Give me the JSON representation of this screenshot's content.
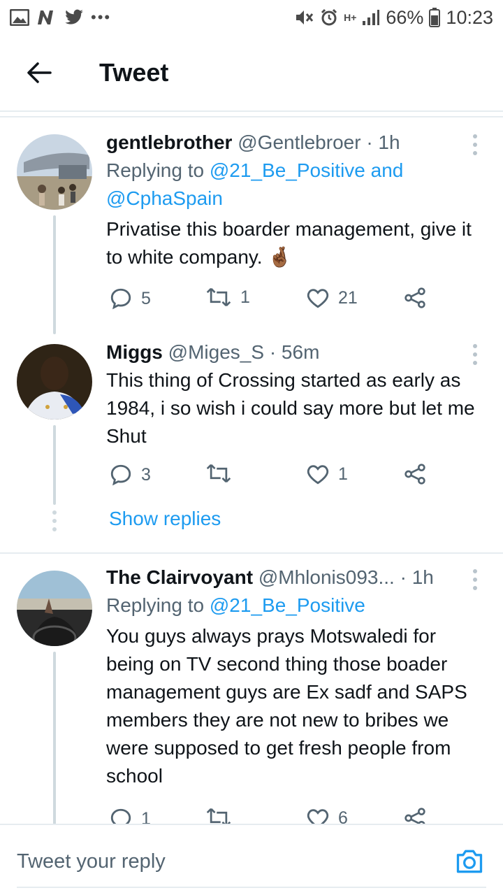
{
  "status_bar": {
    "battery": "66%",
    "time": "10:23",
    "network": "H+"
  },
  "header": {
    "title": "Tweet",
    "back_icon": "arrow-left-icon"
  },
  "tweets": [
    {
      "name": "gentlebrother",
      "handle": "@Gentlebroer",
      "time": "· 1h",
      "replying_prefix": "Replying to",
      "replying_to_1": "@21_Be_Positive and",
      "replying_to_2": "@CphaSpain",
      "text": "Privatise this boarder management, give it to white company.",
      "emoji": "🤞🏾",
      "replies": "5",
      "retweets": "1",
      "likes": "21"
    },
    {
      "name": "Miggs",
      "handle": "@Miges_S",
      "time": "· 56m",
      "text": "This thing of Crossing started as early as 1984,  i so wish i could say more but let me Shut",
      "replies": "3",
      "retweets": "",
      "likes": "1"
    },
    {
      "name": "The Clairvoyant",
      "handle": "@Mhlonis093...",
      "time": "· 1h",
      "replying_prefix": "Replying to",
      "replying_to_1": "@21_Be_Positive",
      "text": "You guys always prays Motswaledi for being on TV second thing those boader management guys are Ex sadf and SAPS members they are not new to bribes we were supposed to get fresh people from school",
      "replies": "1",
      "retweets": "",
      "likes": "6"
    }
  ],
  "show_replies": "Show replies",
  "composer": {
    "placeholder": "Tweet your reply"
  },
  "colors": {
    "accent": "#1d9bf0",
    "text": "#0f1419",
    "secondary": "#536471"
  }
}
